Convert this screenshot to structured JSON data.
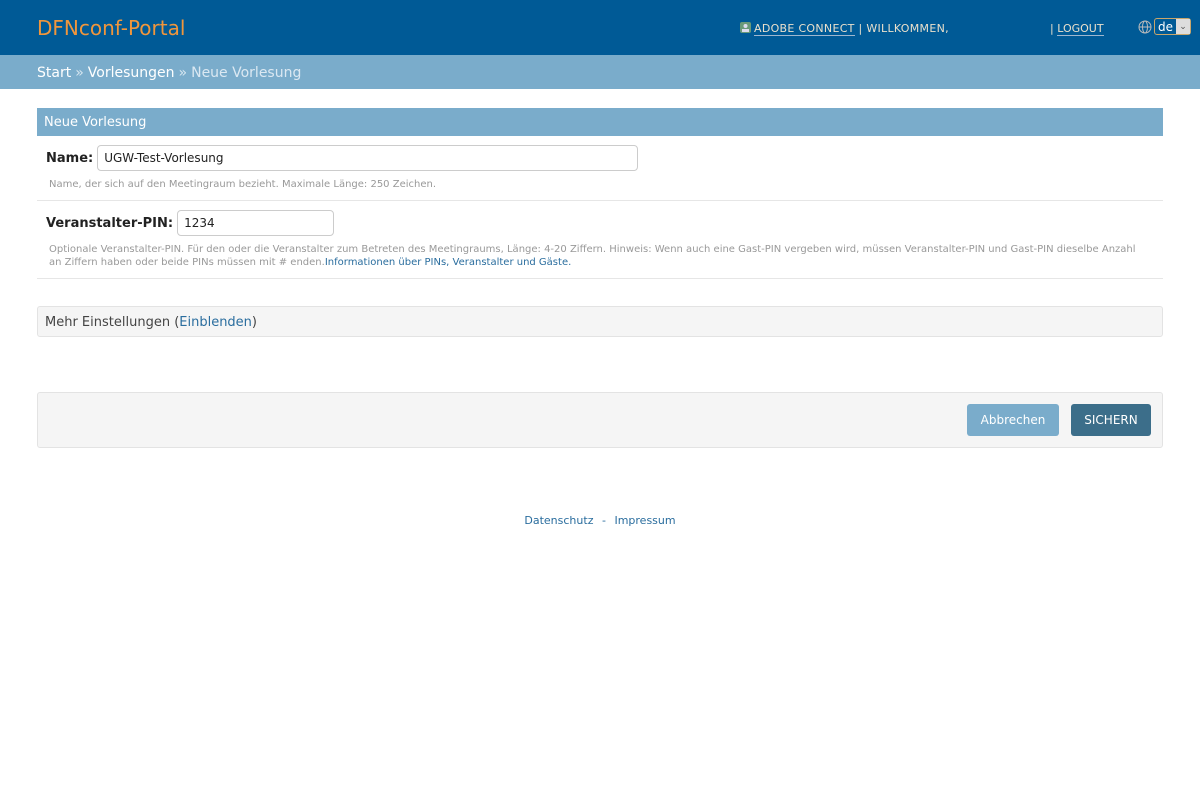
{
  "header": {
    "logo": "DFNconf-Portal",
    "adobe_connect": "ADOBE CONNECT",
    "separator": "|",
    "welcome": "WILLKOMMEN,",
    "logout": "LOGOUT",
    "language": "de"
  },
  "breadcrumb": {
    "start": "Start",
    "sep": "»",
    "vorlesungen": "Vorlesungen",
    "current": "Neue Vorlesung"
  },
  "form": {
    "title": "Neue Vorlesung",
    "name_label": "Name:",
    "name_value": "UGW-Test-Vorlesung",
    "name_help": "Name, der sich auf den Meetingraum bezieht. Maximale Länge: 250 Zeichen.",
    "pin_label": "Veranstalter-PIN:",
    "pin_value": "1234",
    "pin_help": "Optionale Veranstalter-PIN. Für den oder die Veranstalter zum Betreten des Meetingraums, Länge: 4-20 Ziffern. Hinweis: Wenn auch eine Gast-PIN vergeben wird, müssen Veranstalter-PIN und Gast-PIN dieselbe Anzahl an Ziffern haben oder beide PINs müssen mit # enden.",
    "pin_help_link": "Informationen über PINs, Veranstalter und Gäste.",
    "more_label": "Mehr Einstellungen (",
    "more_link": "Einblenden",
    "more_close": ")",
    "cancel": "Abbrechen",
    "save": "SICHERN"
  },
  "footer": {
    "privacy": "Datenschutz",
    "dash": "-",
    "imprint": "Impressum"
  }
}
